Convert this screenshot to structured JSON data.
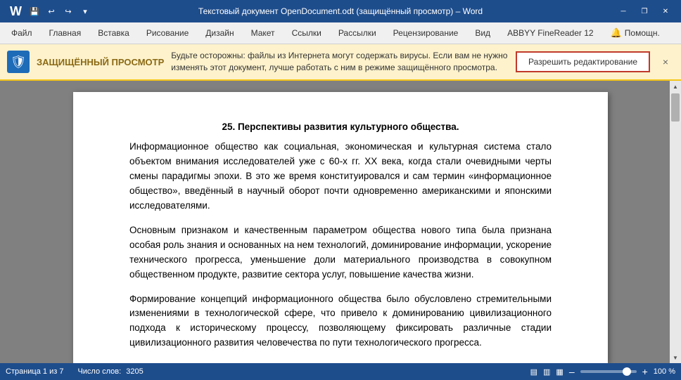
{
  "titlebar": {
    "title": "Текстовый документ OpenDocument.odt (защищённый просмотр)  –  Word",
    "app_name": "Word",
    "quick_access": [
      "save",
      "undo",
      "redo",
      "customize"
    ]
  },
  "ribbon": {
    "tabs": [
      {
        "label": "Файл",
        "active": false
      },
      {
        "label": "Главная",
        "active": false
      },
      {
        "label": "Вставка",
        "active": false
      },
      {
        "label": "Рисование",
        "active": false
      },
      {
        "label": "Дизайн",
        "active": false
      },
      {
        "label": "Макет",
        "active": false
      },
      {
        "label": "Ссылки",
        "active": false
      },
      {
        "label": "Рассылки",
        "active": false
      },
      {
        "label": "Рецензирование",
        "active": false
      },
      {
        "label": "Вид",
        "active": false
      },
      {
        "label": "ABBYY FineReader 12",
        "active": false
      },
      {
        "label": "Помощн.",
        "active": false
      }
    ]
  },
  "protected_bar": {
    "icon_symbol": "🛡",
    "label": "ЗАЩИЩЁННЫЙ ПРОСМОТР",
    "message": "Будьте осторожны: файлы из Интернета могут содержать вирусы. Если вам не нужно изменять этот документ, лучше работать с ним в режиме защищённого просмотра.",
    "allow_button": "Разрешить редактирование",
    "close_symbol": "×"
  },
  "document": {
    "heading": "25. Перспективы развития культурного общества.",
    "paragraphs": [
      "Информационное общество как социальная, экономическая и культурная система стало объектом внимания исследователей уже с 60-х гг. XX века, когда стали очевидными черты смены парадигмы эпохи. В это же время конституировался и сам термин «информационное общество», введённый в научный оборот почти одновременно американскими и японскими исследователями.",
      "Основным признаком и качественным параметром общества нового типа была признана особая роль знания и основанных на нем технологий, доминирование информации, ускорение технического прогресса, уменьшение доли материального производства в совокупном общественном продукте, развитие сектора услуг, повышение качества жизни.",
      "Формирование концепций информационного общества было обусловлено стремительными изменениями в технологической сфере, что привело к доминированию цивилизационного подхода к историческому процессу, позволяющему фиксировать различные стадии цивилизационного развития человечества по пути технологического прогресса."
    ]
  },
  "statusbar": {
    "page_info": "Страница 1 из 7",
    "word_count_label": "Число слов:",
    "word_count": "3205",
    "zoom": "100 %",
    "zoom_minus": "–",
    "zoom_plus": "+"
  },
  "icons": {
    "save": "💾",
    "undo": "↩",
    "redo": "↪",
    "dropdown": "▾",
    "minimize": "─",
    "restore": "❐",
    "close": "✕",
    "scroll_up": "▲",
    "scroll_down": "▼",
    "layout1": "▤",
    "layout2": "▥",
    "layout3": "▦"
  }
}
